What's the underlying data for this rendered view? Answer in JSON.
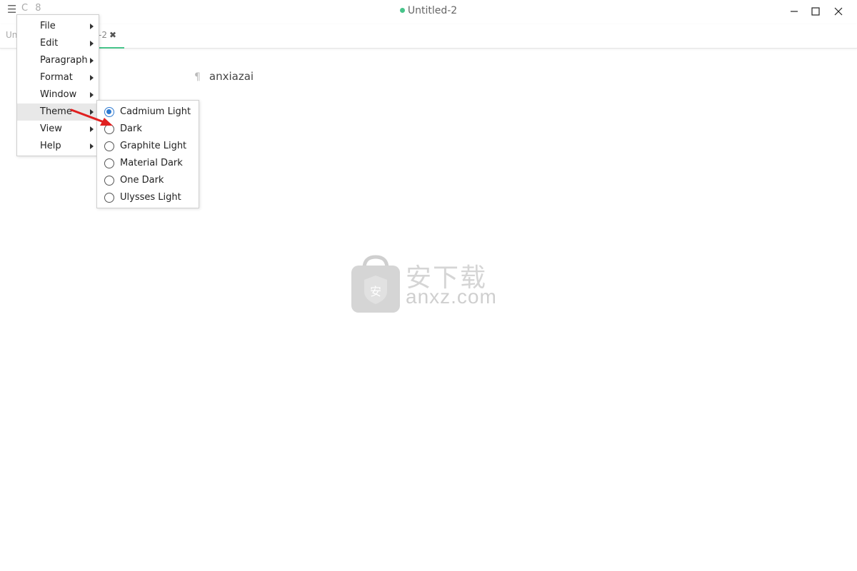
{
  "window": {
    "title": "Untitled-2",
    "titlebar_icons": "C 8",
    "controls": [
      "minimize-icon",
      "maximize-icon",
      "close-icon"
    ]
  },
  "tabs": {
    "left_label": "Un",
    "active_label": "-2",
    "close_glyph": "✖",
    "accent": "#47c48a"
  },
  "editor": {
    "pilcrow": "¶",
    "text": "anxiazai"
  },
  "menu": {
    "items": [
      {
        "label": "File"
      },
      {
        "label": "Edit"
      },
      {
        "label": "Paragraph"
      },
      {
        "label": "Format"
      },
      {
        "label": "Window"
      },
      {
        "label": "Theme"
      },
      {
        "label": "View"
      },
      {
        "label": "Help"
      }
    ],
    "highlighted": "Theme"
  },
  "theme_submenu": {
    "items": [
      {
        "label": "Cadmium Light",
        "checked": true
      },
      {
        "label": "Dark",
        "checked": false
      },
      {
        "label": "Graphite Light",
        "checked": false
      },
      {
        "label": "Material Dark",
        "checked": false
      },
      {
        "label": "One Dark",
        "checked": false
      },
      {
        "label": "Ulysses Light",
        "checked": false
      }
    ],
    "radio_color": "#2e7ad1"
  },
  "watermark": {
    "cn_text": "安下载",
    "en_text": "anxz.com",
    "shield_char": "安"
  }
}
